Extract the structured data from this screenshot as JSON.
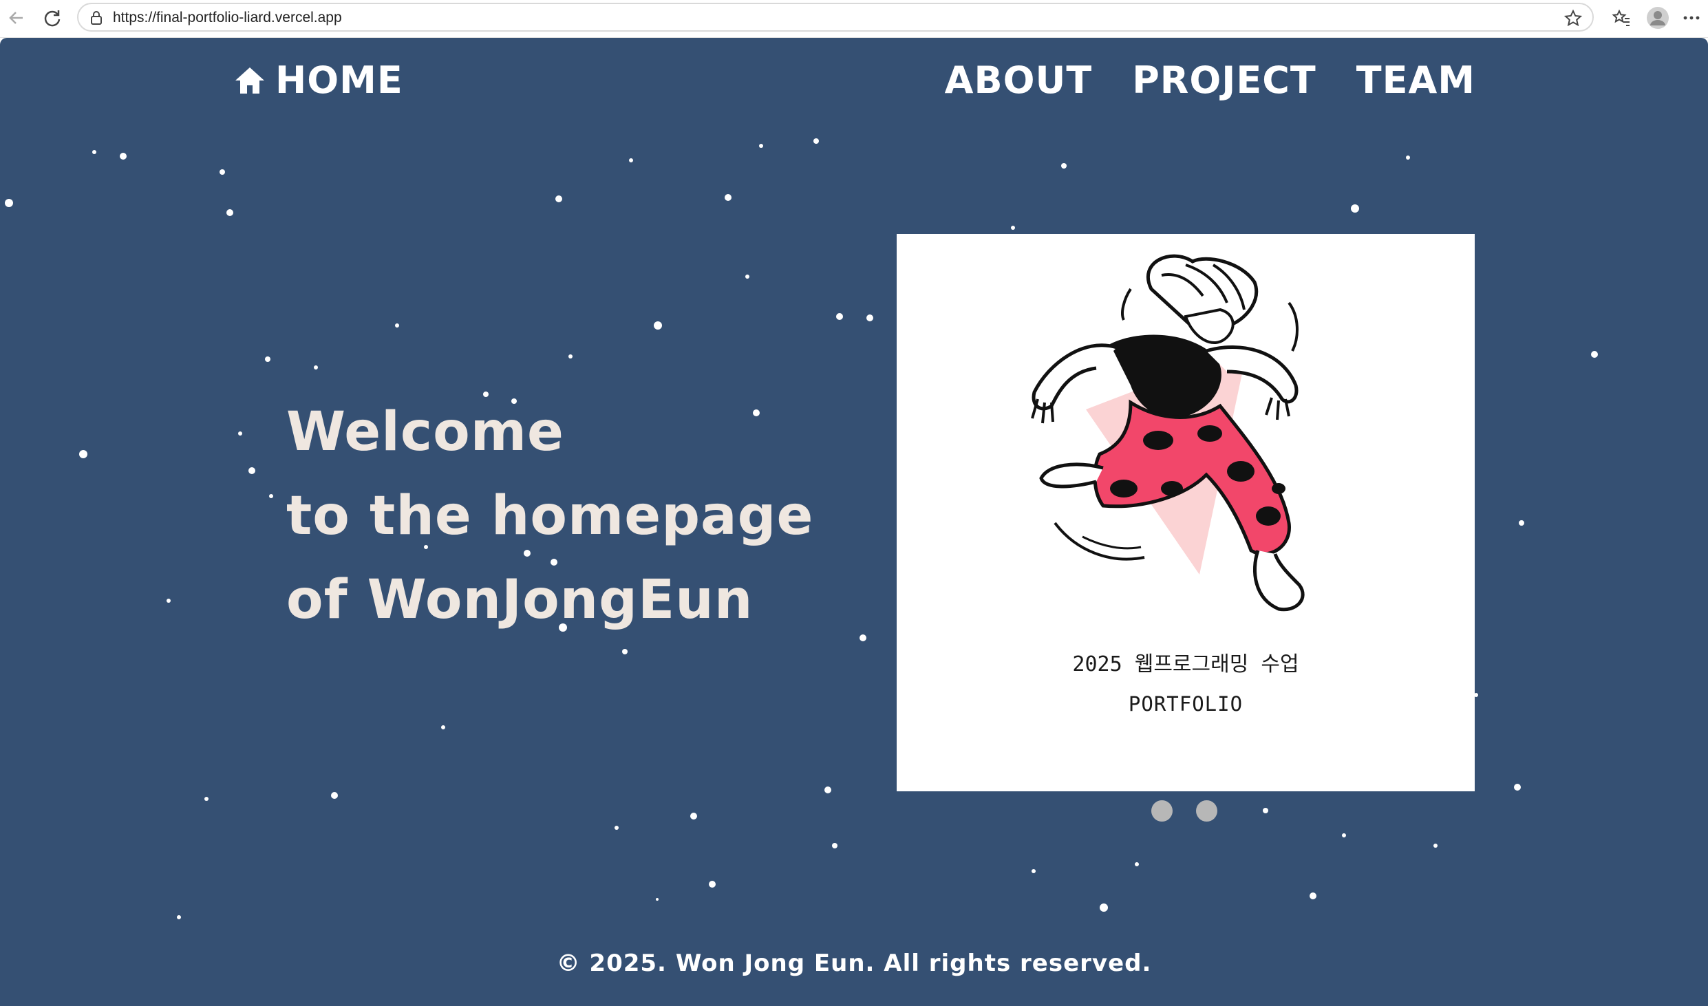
{
  "browser": {
    "url": "https://final-portfolio-liard.vercel.app",
    "icons": [
      "back-icon",
      "reload-icon",
      "lock-icon",
      "bookmark-star-icon",
      "favorites-icon",
      "profile-icon",
      "more-icon"
    ]
  },
  "nav": {
    "home_label": "HOME",
    "items": [
      {
        "label": "ABOUT"
      },
      {
        "label": "PROJECT"
      },
      {
        "label": "TEAM"
      }
    ]
  },
  "hero": {
    "lines": [
      "Welcome",
      "to the homepage",
      "of WonJongEun"
    ]
  },
  "slide": {
    "caption_1": "2025 웹프로그래밍 수업",
    "caption_2": "PORTFOLIO",
    "dots_count": 2
  },
  "footer": {
    "text": "© 2025. Won Jong Eun. All rights reserved."
  },
  "colors": {
    "background": "#355073",
    "hero_text": "#efe7e0",
    "accent_pink": "#f2476a"
  }
}
